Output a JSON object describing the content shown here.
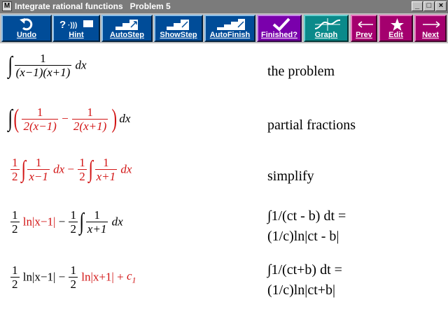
{
  "window": {
    "title": "Integrate rational functions   Problem 5",
    "app_icon": "M"
  },
  "window_buttons": {
    "minimize": "_",
    "maximize": "□",
    "close": "×"
  },
  "toolbar": {
    "undo": "Undo",
    "hint": "Hint",
    "autostep": "AutoStep",
    "showstep": "ShowStep",
    "autofinish": "AutoFinish",
    "finished": "Finished?",
    "graph": "Graph",
    "prev": "Prev",
    "edit": "Edit",
    "next": "Next"
  },
  "colors": {
    "toolbar_blue": "#004c98",
    "teal": "#0a8a8a",
    "purple": "#7a00ac",
    "magenta": "#a4006e",
    "highlight_red": "#d21414"
  },
  "steps": [
    {
      "description": "the problem"
    },
    {
      "description": "partial fractions"
    },
    {
      "description": "simplify"
    },
    {
      "description_line1": "∫1/(ct - b) dt =",
      "description_line2": "(1/c)ln|ct - b|"
    },
    {
      "description_line1": "∫1/(ct+b) dt =",
      "description_line2": "(1/c)ln|ct+b|"
    }
  ],
  "math": {
    "one": "1",
    "two": "2",
    "dx": "dx",
    "den_problem": "(x−1)(x+1)",
    "den_pf1": "2(x−1)",
    "den_pf2": "2(x+1)",
    "den_xm1": "x−1",
    "den_xp1": "x+1",
    "ln_xm1": "ln|x−1|",
    "ln_xp1": "ln|x+1|",
    "minus": "−",
    "plus": "+",
    "const": "c",
    "const_sub": "1"
  }
}
